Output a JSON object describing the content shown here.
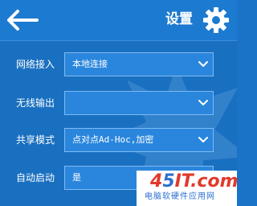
{
  "header": {
    "title": "设置",
    "back_icon": "back-arrow-icon",
    "settings_icon": "gear-icon"
  },
  "form": {
    "rows": [
      {
        "label": "网络接入",
        "value": "本地连接"
      },
      {
        "label": "无线输出",
        "value": ""
      },
      {
        "label": "共享模式",
        "value": "点对点Ad-Hoc,加密"
      },
      {
        "label": "自动启动",
        "value": "是"
      }
    ]
  },
  "watermark": {
    "logo_a": "4",
    "logo_b": "5",
    "logo_c": "IT.com",
    "subtitle": "电脑软硬件应用网"
  },
  "colors": {
    "header_bg": "#1c7ad0",
    "content_bg": "#1a70c0",
    "field_bg": "#2a86dd",
    "field_border": "#7fbaf0"
  }
}
